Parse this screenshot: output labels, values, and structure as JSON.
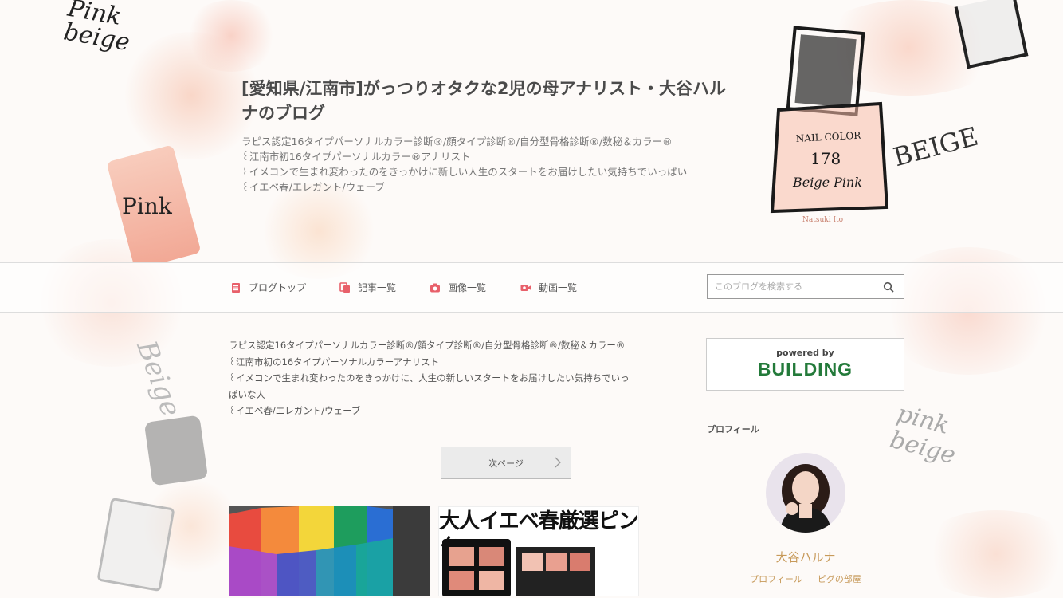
{
  "header": {
    "blog_title": "[愛知県/江南市]がっつりオタクな2児の母アナリスト・大谷ハルナのブログ",
    "description_lines": [
      "ラピス認定16タイプパーソナルカラー診断®/顔タイプ診断®/自分型骨格診断®/数秘＆カラー®",
      "꒰江南市初16タイプパーソナルカラー®アナリスト",
      "꒰イメコンで生まれ変わったのをきっかけに新しい人生のスタートをお届けしたい気持ちでいっぱい",
      "꒰イエベ春/エレガント/ウェーブ"
    ],
    "deco_texts": {
      "pink_beige": "Pink beige",
      "pink": "Pink",
      "beige_upper": "BEIGE",
      "nail_label_1": "NAIL COLOR",
      "nail_label_2": "178",
      "nail_label_3": "Beige Pink",
      "signature": "Natsuki Ito"
    }
  },
  "nav": {
    "items": [
      {
        "label": "ブログトップ",
        "icon": "document-icon"
      },
      {
        "label": "記事一覧",
        "icon": "copy-icon"
      },
      {
        "label": "画像一覧",
        "icon": "camera-icon"
      },
      {
        "label": "動画一覧",
        "icon": "video-icon"
      }
    ],
    "search_placeholder": "このブログを検索する"
  },
  "main": {
    "intro_lines": [
      "ラピス認定16タイプパーソナルカラー診断®/顔タイプ診断®/自分型骨格診断®/数秘＆カラー®",
      "꒰江南市初の16タイプパーソナルカラーアナリスト",
      "꒰イメコンで生まれ変わったのをきっかけに、人生の新しいスタートをお届けしたい気持ちでいっ",
      "ぱいな人",
      "꒰イエベ春/エレガント/ウェーブ"
    ],
    "next_page_label": "次ページ",
    "thumbnails": [
      {
        "caption": ""
      },
      {
        "caption": "大人イエベ春厳選ピンク"
      }
    ]
  },
  "sidebar": {
    "banner_sub": "powered by",
    "banner_main": "BUILDING",
    "profile_heading": "プロフィール",
    "profile_name": "大谷ハルナ",
    "profile_links": [
      "プロフィール",
      "ピグの部屋"
    ],
    "deco_text": "pink beige"
  },
  "colors": {
    "accent_icon": "#e8606a",
    "brand_green": "#237a3a",
    "profile_gold": "#c79a5a"
  }
}
